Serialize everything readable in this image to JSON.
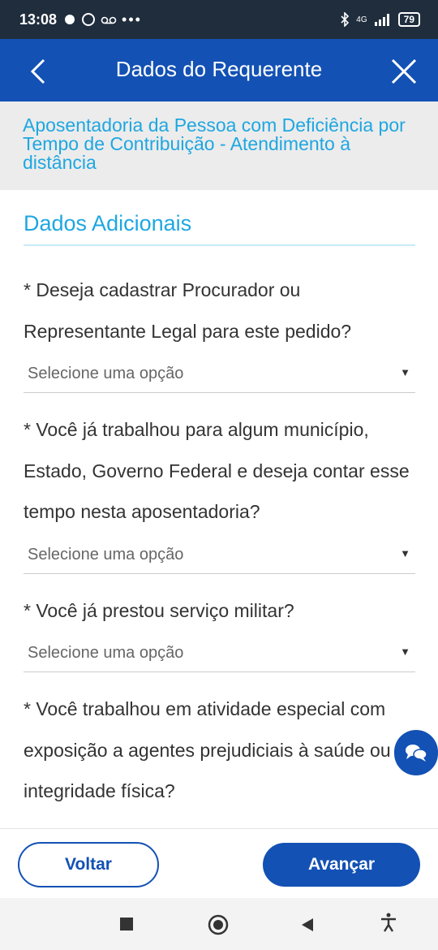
{
  "status": {
    "time": "13:08",
    "battery": "79",
    "network": "4G"
  },
  "header": {
    "title": "Dados do Requerente"
  },
  "service": {
    "title": "Aposentadoria da Pessoa com Deficiência por Tempo de Contribuição - Atendimento à distância"
  },
  "section": {
    "title": "Dados Adicionais"
  },
  "questions": [
    {
      "text": "* Deseja cadastrar Procurador ou Representante Legal para este pedido?",
      "select_value": "Selecione uma opção"
    },
    {
      "text": "* Você já trabalhou para algum município, Estado, Governo Federal e deseja contar esse tempo nesta aposentadoria?",
      "select_value": "Selecione uma opção"
    },
    {
      "text": "* Você já prestou serviço militar?",
      "select_value": "Selecione uma opção"
    },
    {
      "text": "* Você trabalhou em atividade especial com exposição a agentes prejudiciais à saúde ou à integridade física?"
    }
  ],
  "buttons": {
    "back": "Voltar",
    "next": "Avançar"
  },
  "colors": {
    "primary": "#1351b4",
    "accent": "#1ea7e1",
    "status_bar": "#1f2d3d"
  },
  "icons": {
    "back": "chevron-left-icon",
    "close": "close-icon",
    "chat": "chat-icon"
  }
}
